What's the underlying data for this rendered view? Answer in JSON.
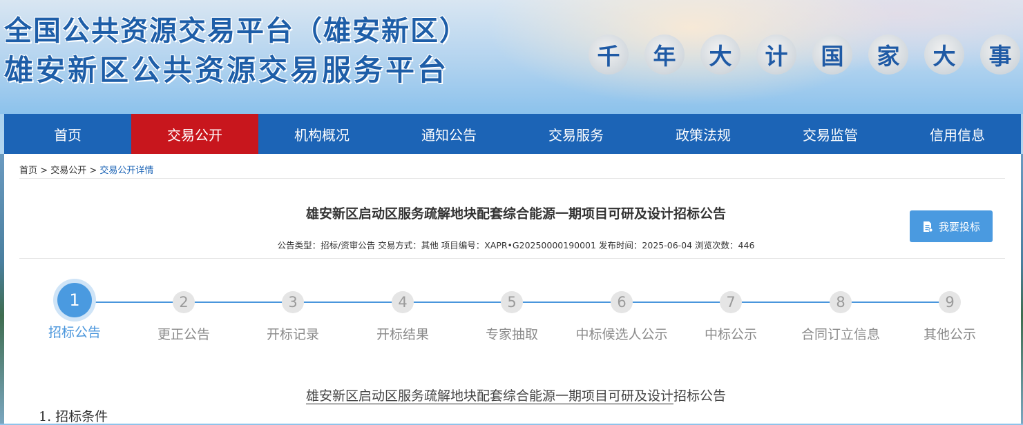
{
  "header": {
    "title_line1": "全国公共资源交易平台（雄安新区）",
    "title_line2": "雄安新区公共资源交易服务平台",
    "slogan": [
      "千",
      "年",
      "大",
      "计",
      "国",
      "家",
      "大",
      "事"
    ]
  },
  "nav": {
    "items": [
      {
        "label": "首页"
      },
      {
        "label": "交易公开",
        "active": true
      },
      {
        "label": "机构概况"
      },
      {
        "label": "通知公告"
      },
      {
        "label": "交易服务"
      },
      {
        "label": "政策法规"
      },
      {
        "label": "交易监管"
      },
      {
        "label": "信用信息"
      }
    ]
  },
  "breadcrumb": {
    "home": "首页",
    "sep1": " > ",
    "section": "交易公开",
    "sep2": " > ",
    "current": "交易公开详情"
  },
  "notice": {
    "title": "雄安新区启动区服务疏解地块配套综合能源一期项目可研及设计招标公告",
    "meta": "公告类型：招标/资审公告 交易方式：其他 项目编号：XAPR•G20250000190001 发布时间：2025-06-04 浏览次数：446",
    "bid_button": "我要投标",
    "bid_icon": "document-icon"
  },
  "steps": [
    {
      "num": "1",
      "label": "招标公告",
      "active": true
    },
    {
      "num": "2",
      "label": "更正公告"
    },
    {
      "num": "3",
      "label": "开标记录"
    },
    {
      "num": "4",
      "label": "开标结果"
    },
    {
      "num": "5",
      "label": "专家抽取"
    },
    {
      "num": "6",
      "label": "中标候选人公示"
    },
    {
      "num": "7",
      "label": "中标公示"
    },
    {
      "num": "8",
      "label": "合同订立信息"
    },
    {
      "num": "9",
      "label": "其他公示"
    }
  ],
  "document": {
    "title_underlined": "雄安新区启动区服务疏解地块配套综合能源一期项目可研及设计",
    "title_rest": "招标公告",
    "section1": "1. 招标条件"
  },
  "colors": {
    "nav_bg": "#1c64b6",
    "nav_active": "#c8161d",
    "accent": "#4a9ae0",
    "title_blue": "#1e5ea8"
  }
}
